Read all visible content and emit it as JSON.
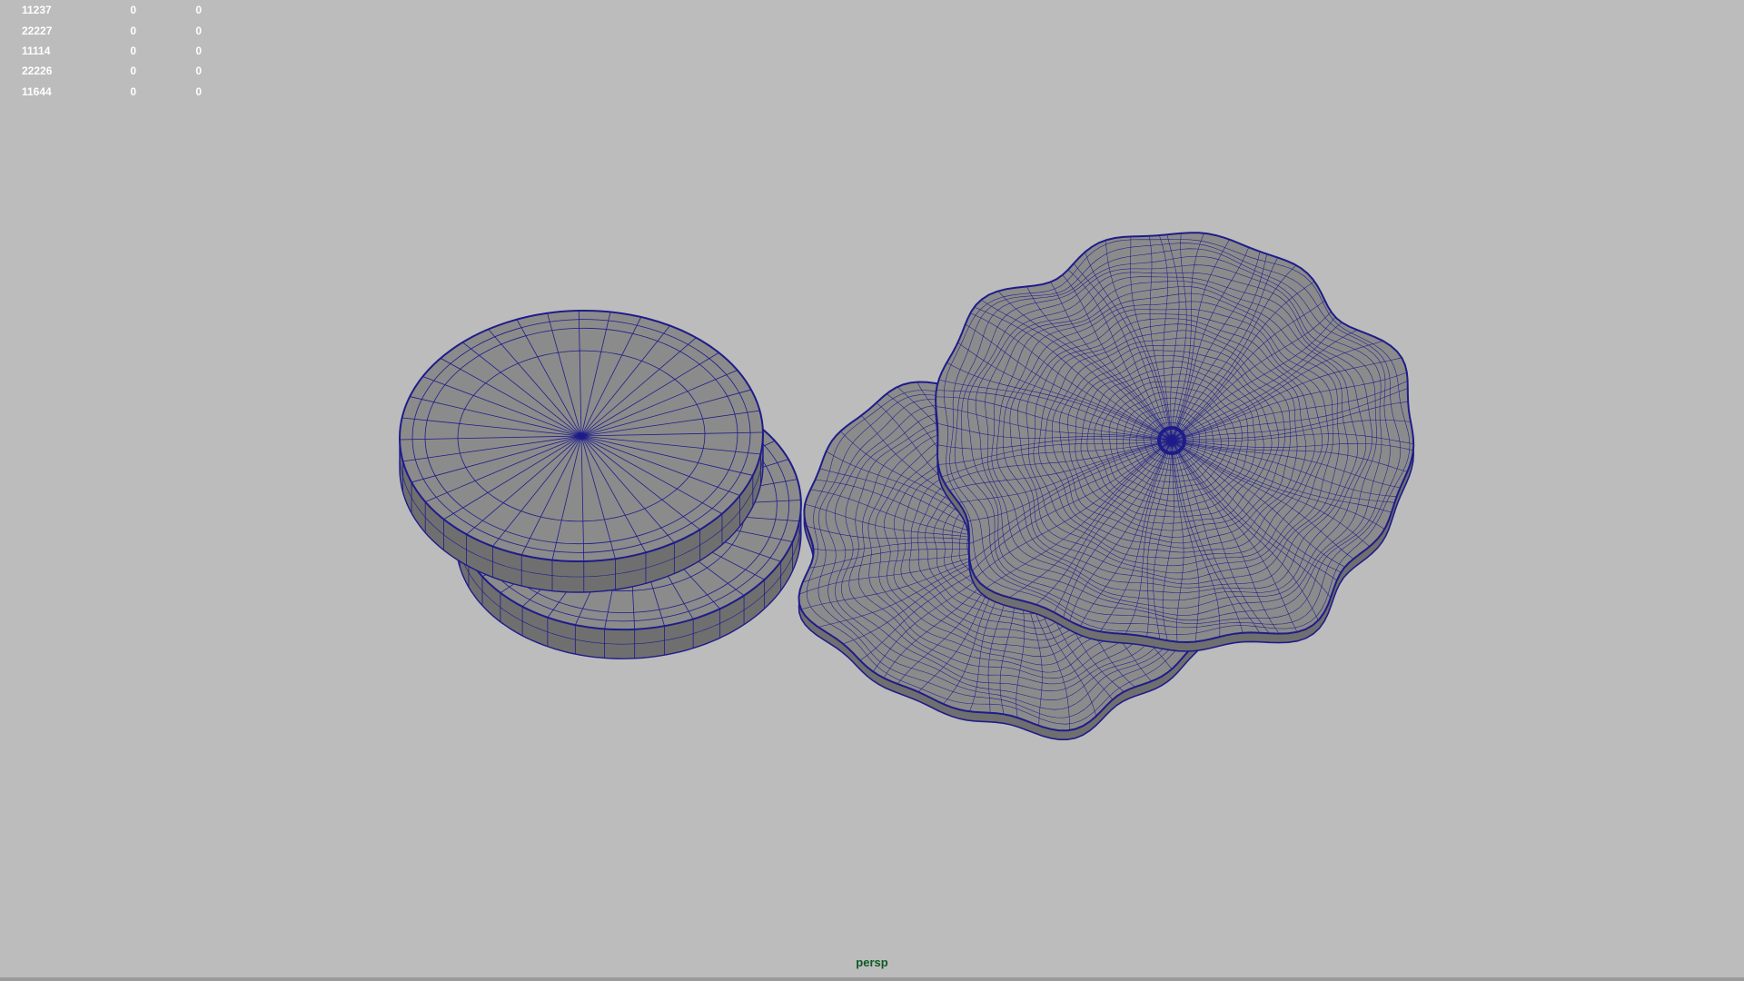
{
  "heads_up_display": {
    "rows": [
      [
        "11237",
        "0",
        "0"
      ],
      [
        "22227",
        "0",
        "0"
      ],
      [
        "11114",
        "0",
        "0"
      ],
      [
        "22226",
        "0",
        "0"
      ],
      [
        "11644",
        "0",
        "0"
      ]
    ]
  },
  "viewport": {
    "camera_label": "persp",
    "background_color": "#bcbcbc",
    "wireframe_color": "#1e1c8a",
    "mesh_color": "#8b8b8b",
    "objects": [
      "cylinder-slice-top",
      "cylinder-slice-bottom",
      "organic-slice-back",
      "organic-slice-front"
    ]
  }
}
